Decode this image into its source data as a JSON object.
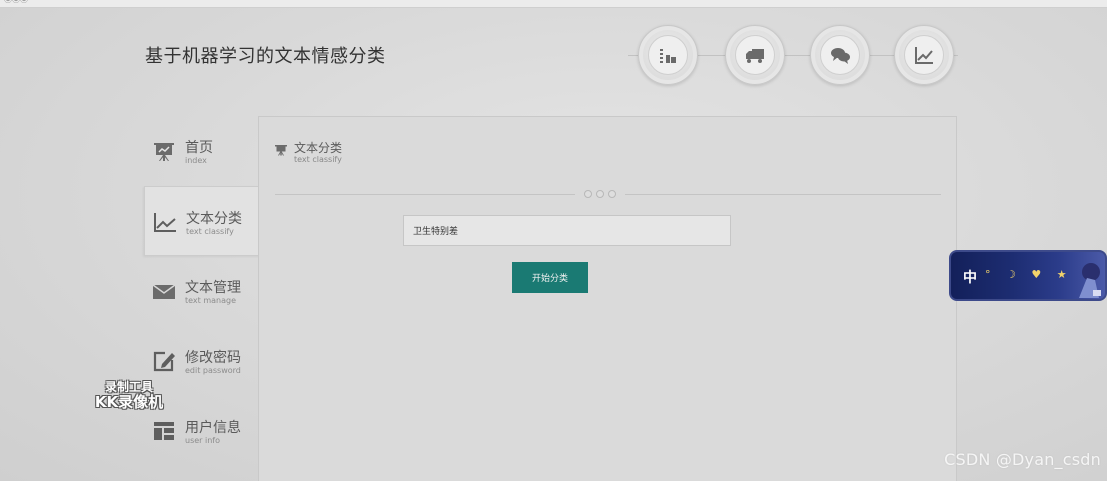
{
  "app": {
    "title": "基于机器学习的文本情感分类",
    "top_logo": "ⓄⓄⓄ"
  },
  "top_nav": [
    {
      "name": "stats",
      "icon": "bar-stack-icon"
    },
    {
      "name": "truck",
      "icon": "truck-icon"
    },
    {
      "name": "chat",
      "icon": "chat-bubbles-icon"
    },
    {
      "name": "chart",
      "icon": "line-chart-icon"
    }
  ],
  "sidebar": {
    "items": [
      {
        "cn": "首页",
        "en": "index",
        "icon": "presentation-board-icon",
        "active": false
      },
      {
        "cn": "文本分类",
        "en": "text classify",
        "icon": "line-chart-icon",
        "active": true
      },
      {
        "cn": "文本管理",
        "en": "text manage",
        "icon": "envelope-icon",
        "active": false
      },
      {
        "cn": "修改密码",
        "en": "edit password",
        "icon": "edit-pencil-icon",
        "active": false
      },
      {
        "cn": "用户信息",
        "en": "user info",
        "icon": "user-card-icon",
        "active": false
      }
    ]
  },
  "panel": {
    "title_cn": "文本分类",
    "title_en": "text classify",
    "input_value": "卫生特别差",
    "button_label": "开始分类"
  },
  "overlays": {
    "recorder_line1": "录制工具",
    "recorder_line2": "KK录像机",
    "csdn": "CSDN @Dyan_csdn",
    "ime_label": "中"
  },
  "colors": {
    "accent": "#1a7a73",
    "background": "#d8d8d8",
    "panel": "#dadada"
  }
}
